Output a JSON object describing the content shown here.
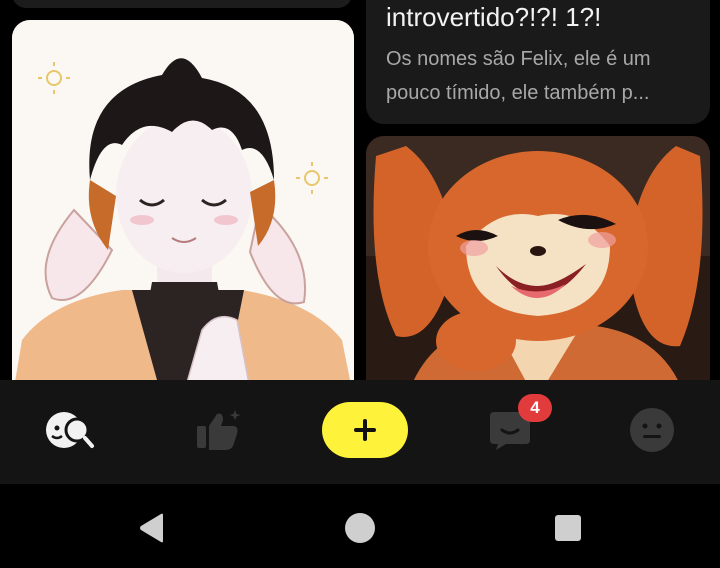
{
  "feed": {
    "text_card": {
      "title": "introvertido?!?! 1?!",
      "description": "Os nomes são Felix, ele é um pouco tímido, ele também p..."
    },
    "left_image_icon": "character-portrait-image",
    "right_image_icon": "character-portrait-image"
  },
  "bottom_nav": {
    "items": [
      {
        "id": "discover",
        "icon": "discover-icon"
      },
      {
        "id": "likes",
        "icon": "thumbs-up-icon"
      },
      {
        "id": "create",
        "icon": "plus-icon"
      },
      {
        "id": "chats",
        "icon": "chat-bubble-icon",
        "badge": "4"
      },
      {
        "id": "profile",
        "icon": "face-icon"
      }
    ],
    "accent_color": "#fff23a",
    "badge_color": "#e23b3b"
  },
  "system_nav": {
    "items": [
      "back-icon",
      "home-icon",
      "recents-icon"
    ]
  }
}
